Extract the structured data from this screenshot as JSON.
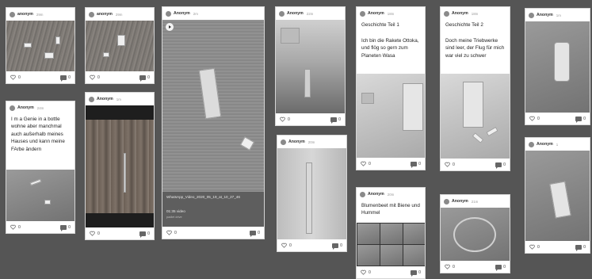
{
  "posts": [
    {
      "author": "anonym",
      "time": "29m",
      "likes": "0",
      "comments": "0"
    },
    {
      "author": "Anonym",
      "time": "24m",
      "text": "I m a Genie in a bottle wohne aber manchmal auch außerhalb meines Hauses und kann meine FArbe ändern",
      "likes": "0",
      "comments": "0"
    },
    {
      "author": "anonym",
      "time": "29m",
      "likes": "0",
      "comments": "0"
    },
    {
      "author": "Anonym",
      "time": "1m",
      "likes": "0",
      "comments": "0"
    },
    {
      "author": "Anonym",
      "time": "2m",
      "video_title": "WhatsApp_Video_2020_05_19_at_10_27_46",
      "video_meta": "01:35 video",
      "video_sub": "padlet drive",
      "likes": "0",
      "comments": "0"
    },
    {
      "author": "Anonym",
      "time": "22m",
      "likes": "0",
      "comments": "0"
    },
    {
      "author": "Anonym",
      "time": "20m",
      "likes": "0",
      "comments": "0"
    },
    {
      "author": "Anonym",
      "time": "18m",
      "title": "Geschichte Teil 1",
      "text": "Ich bin die Rakete Ottoka, und flög so gern zum Planeten Wasa",
      "likes": "0",
      "comments": "0"
    },
    {
      "author": "Anonym",
      "time": "20m",
      "text": "Blumenbeet mit Biene und Hummel",
      "likes": "0",
      "comments": "0"
    },
    {
      "author": "Anonym",
      "time": "18m",
      "title": "Geschichte Teil 2",
      "text": "Doch meine Triebwerke sind leer, der Flug für mich war viel zu schwer",
      "likes": "0",
      "comments": "0"
    },
    {
      "author": "Anonym",
      "time": "21m",
      "likes": "0",
      "comments": "0"
    },
    {
      "author": "Anonym",
      "time": "1m",
      "likes": "0",
      "comments": "0"
    },
    {
      "author": "Anonym",
      "time": "1",
      "likes": "0",
      "comments": "0"
    }
  ]
}
